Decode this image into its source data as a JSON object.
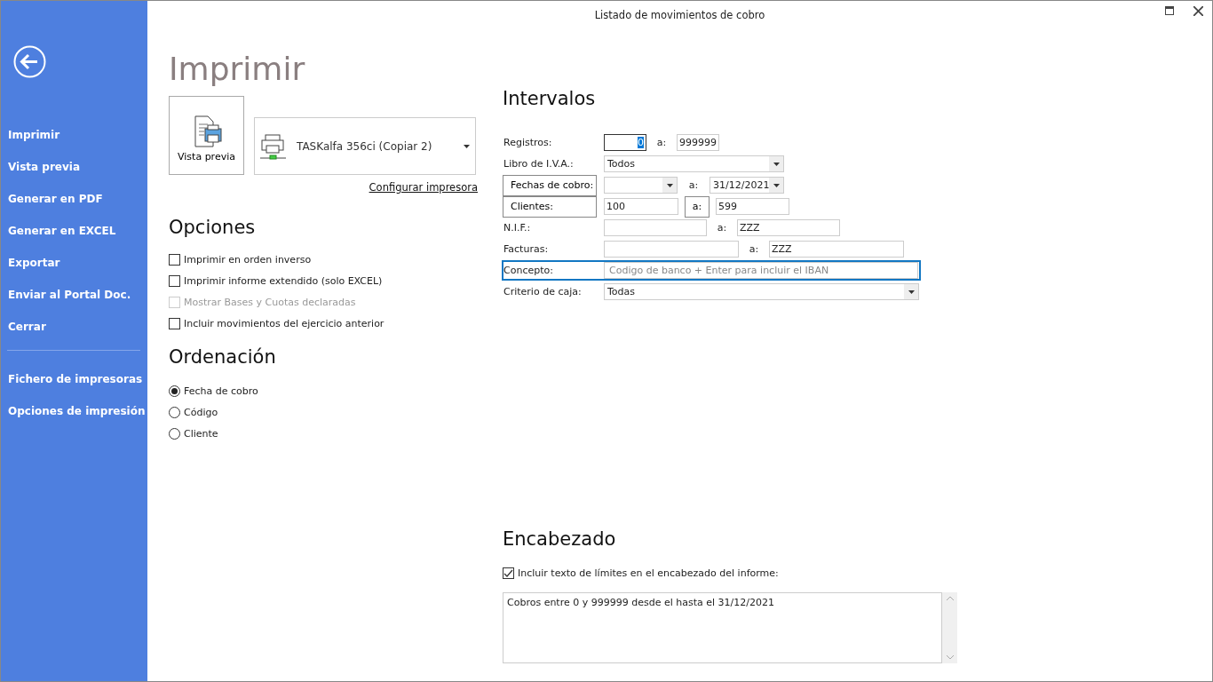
{
  "window": {
    "title": "Listado de movimientos de cobro"
  },
  "sidebar": {
    "items": [
      {
        "label": "Imprimir"
      },
      {
        "label": "Vista previa"
      },
      {
        "label": "Generar en PDF"
      },
      {
        "label": "Generar en EXCEL"
      },
      {
        "label": "Exportar"
      },
      {
        "label": "Enviar al Portal Doc."
      },
      {
        "label": "Cerrar"
      }
    ],
    "secondary_items": [
      {
        "label": "Fichero de impresoras"
      },
      {
        "label": "Opciones de impresión"
      }
    ]
  },
  "page_title": "Imprimir",
  "preview_button": {
    "label": "Vista previa"
  },
  "printer": {
    "value": "TASKalfa 356ci (Copiar 2)"
  },
  "configure_link": "Configurar impresora",
  "options": {
    "title": "Opciones",
    "items": [
      {
        "label": "Imprimir en orden inverso",
        "checked": false,
        "disabled": false
      },
      {
        "label": "Imprimir informe extendido (solo EXCEL)",
        "checked": false,
        "disabled": false
      },
      {
        "label": "Mostrar Bases y Cuotas declaradas",
        "checked": false,
        "disabled": true
      },
      {
        "label": "Incluir movimientos del ejercicio anterior",
        "checked": false,
        "disabled": false
      }
    ]
  },
  "sorting": {
    "title": "Ordenación",
    "items": [
      {
        "label": "Fecha de cobro",
        "selected": true
      },
      {
        "label": "Código",
        "selected": false
      },
      {
        "label": "Cliente",
        "selected": false
      }
    ]
  },
  "intervals": {
    "title": "Intervalos",
    "rows": [
      {
        "label": {
          "kind": "text",
          "text": "Registros:"
        },
        "from": {
          "kind": "text",
          "value": "0",
          "focused": true
        },
        "to_label": {
          "kind": "text",
          "text": "a:"
        },
        "to": {
          "kind": "text",
          "value": "999999"
        }
      },
      {
        "label": {
          "kind": "text",
          "text": "Libro de I.V.A.:"
        },
        "from": {
          "kind": "combo",
          "value": "Todos"
        }
      },
      {
        "label": {
          "kind": "button",
          "text": "Fechas de cobro:"
        },
        "from": {
          "kind": "combo"
        },
        "to_label": {
          "kind": "text",
          "text": "a:"
        },
        "to": {
          "kind": "combo",
          "value": "31/12/2021"
        }
      },
      {
        "label": {
          "kind": "button",
          "text": "Clientes:"
        },
        "from": {
          "kind": "text",
          "value": "100"
        },
        "to_label": {
          "kind": "button",
          "text": "a:"
        },
        "to": {
          "kind": "text",
          "value": "599"
        }
      },
      {
        "label": {
          "kind": "text",
          "text": "N.I.F.:"
        },
        "from": {
          "kind": "text"
        },
        "to_label": {
          "kind": "text",
          "text": "a:"
        },
        "to": {
          "kind": "text",
          "value": "ZZZ"
        }
      },
      {
        "label": {
          "kind": "text",
          "text": "Facturas:"
        },
        "from": {
          "kind": "text"
        },
        "to_label": {
          "kind": "text",
          "text": "a:"
        },
        "to": {
          "kind": "text",
          "value": "ZZZ"
        }
      },
      {
        "label": {
          "kind": "text",
          "text": "Concepto:"
        },
        "focused": true,
        "from": {
          "kind": "text",
          "placeholder": "Codigo de banco + Enter para incluir el IBAN"
        }
      },
      {
        "label": {
          "kind": "text",
          "text": "Criterio de caja:"
        },
        "from": {
          "kind": "combo",
          "value": "Todas"
        }
      }
    ]
  },
  "header": {
    "title": "Encabezado",
    "include": {
      "label": "Incluir texto de límites en el encabezado del informe:",
      "checked": true
    },
    "text": "Cobros entre 0 y 999999 desde el  hasta el 31/12/2021"
  }
}
